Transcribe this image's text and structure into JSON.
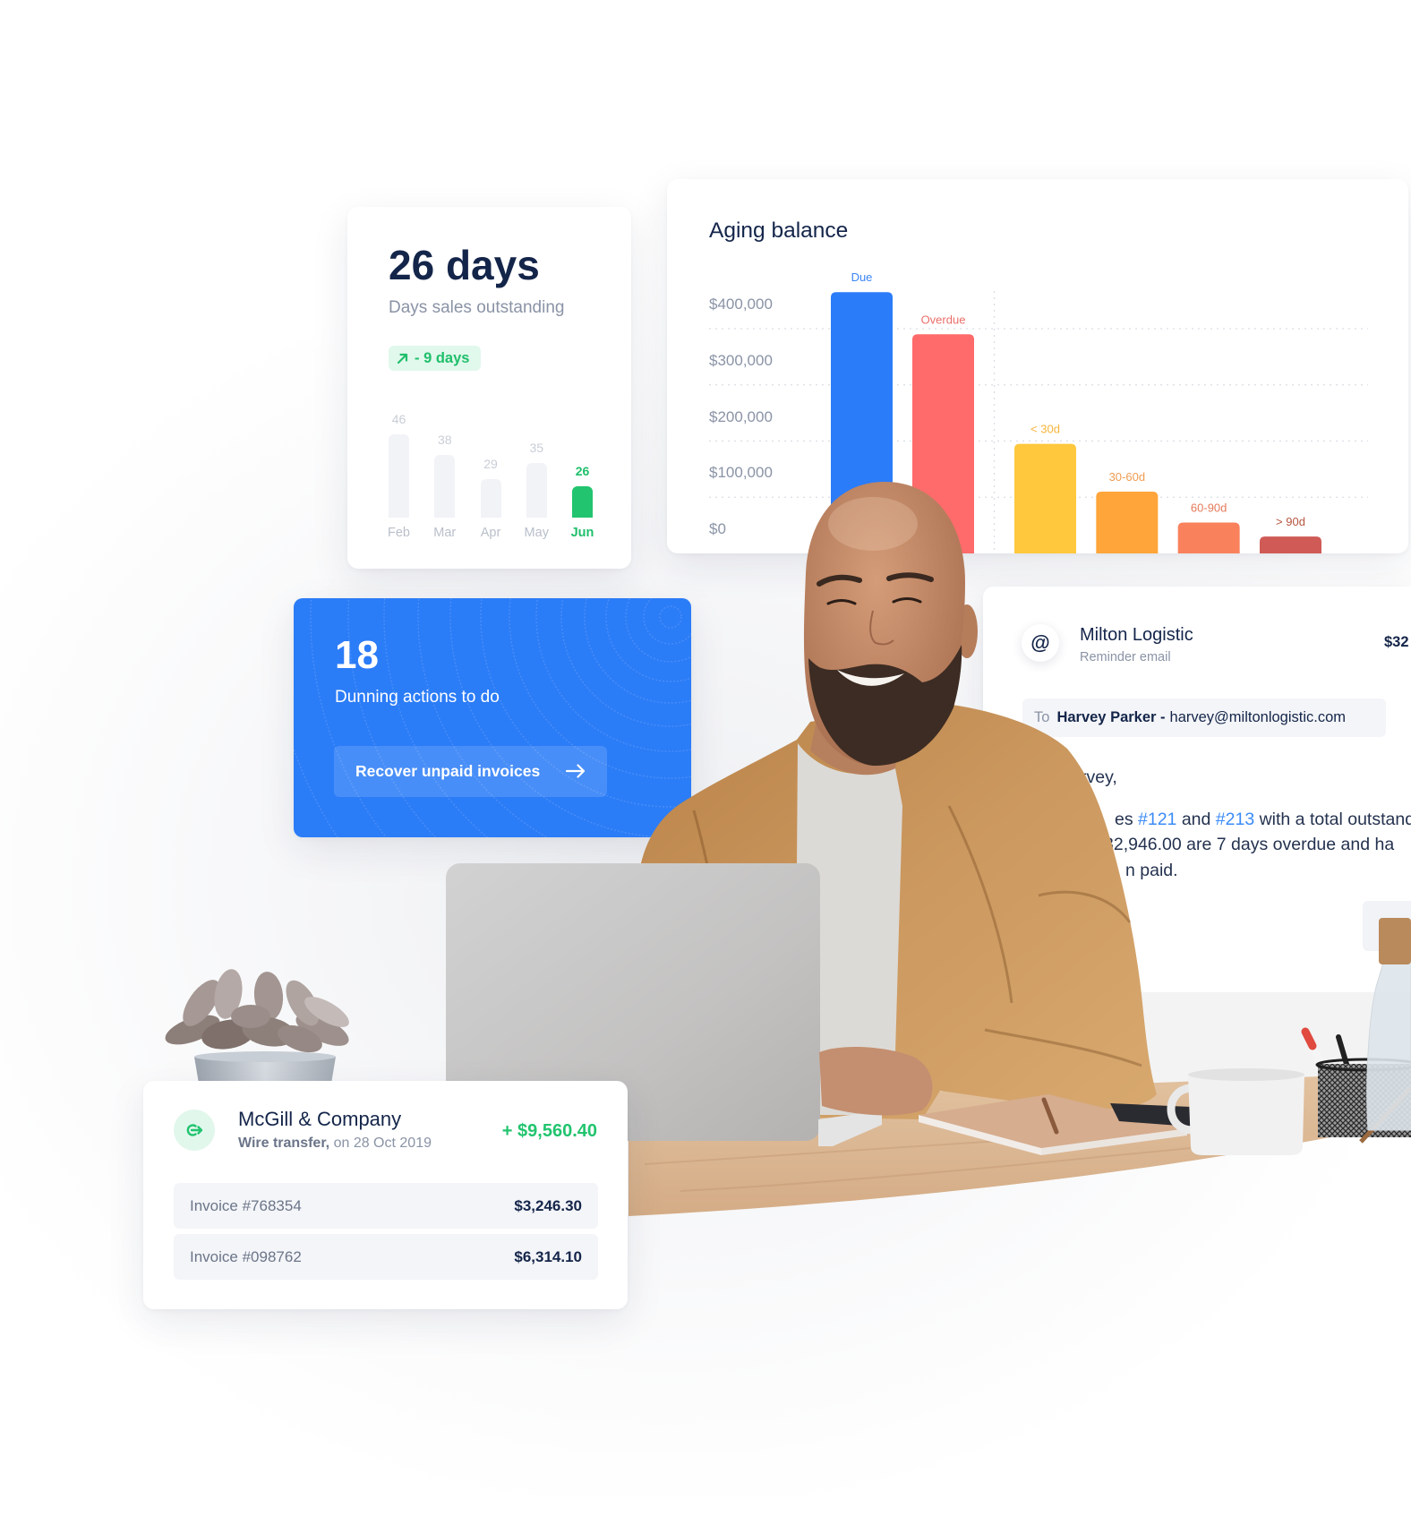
{
  "dso_card": {
    "value": "26 days",
    "label": "Days sales outstanding",
    "change": {
      "icon": "arrow-up-right-icon",
      "text": "- 9 days"
    }
  },
  "aging_card": {
    "title": "Aging balance"
  },
  "dunning_card": {
    "count": "18",
    "label": "Dunning actions to do",
    "button_label": "Recover unpaid invoices",
    "button_icon": "arrow-right-icon"
  },
  "email_card": {
    "icon": "at-sign-icon",
    "icon_glyph": "@",
    "company": "Milton Logistic",
    "type": "Reminder email",
    "amount_partial": "$32",
    "to_label": "To",
    "recipient_name": "Harvey Parker -",
    "recipient_email": "harvey@miltonlogistic.com",
    "body_lines": [
      [
        {
          "text": "rvey,"
        }
      ],
      [
        {
          "text": "es "
        },
        {
          "text": "#121",
          "link": true
        },
        {
          "text": " and "
        },
        {
          "text": "#213",
          "link": true
        },
        {
          "text": " with a total outstand"
        }
      ],
      [
        {
          "text": "32,946.00 are 7 days overdue and ha"
        }
      ],
      [
        {
          "text": "n paid."
        }
      ]
    ]
  },
  "payment_card": {
    "icon": "transfer-in-icon",
    "company": "McGill & Company",
    "method": "Wire transfer,",
    "date": " on 28 Oct 2019",
    "amount": "+ $9,560.40",
    "invoices": [
      {
        "label": "Invoice #768354",
        "amount": "$3,246.30"
      },
      {
        "label": "Invoice #098762",
        "amount": "$6,314.10"
      }
    ]
  },
  "colors": {
    "navy_text": "#14254a",
    "muted_text": "#8a93a6",
    "positive_green": "#22c46f",
    "primary_blue": "#2b7cf7",
    "link_blue": "#3b8bf6"
  },
  "chart_data": [
    {
      "id": "aging-balance",
      "type": "bar",
      "title": "Aging balance",
      "categories": [
        "Due",
        "Overdue",
        "< 30d",
        "30-60d",
        "60-90d",
        "> 90d"
      ],
      "groups": [
        "total",
        "total",
        "aging",
        "aging",
        "aging",
        "aging"
      ],
      "values": [
        465000,
        390000,
        195000,
        110000,
        55000,
        30000
      ],
      "colors": [
        "#2b7cf8",
        "#ff6b6b",
        "#ffc83d",
        "#ffa53a",
        "#f9825d",
        "#cf5a56"
      ],
      "label_colors": [
        "#3a86f5",
        "#ea6f6a",
        "#f7b53c",
        "#ef9c52",
        "#e57a5a",
        "#b65640"
      ],
      "yticks": [
        0,
        100000,
        200000,
        300000,
        400000
      ],
      "ytick_labels": [
        "$0",
        "$100,000",
        "$200,000",
        "$300,000",
        "$400,000"
      ],
      "ylim": [
        0,
        400000
      ],
      "xlabel": "",
      "ylabel": "",
      "grid": true,
      "legend": "none"
    },
    {
      "id": "dso-history",
      "type": "bar",
      "title": "Days sales outstanding",
      "categories": [
        "Feb",
        "Mar",
        "Apr",
        "May",
        "Jun"
      ],
      "values": [
        46,
        38,
        29,
        35,
        26
      ],
      "highlight": "Jun",
      "highlight_color": "#22c46f",
      "xlabel": "",
      "ylabel": "",
      "grid": false,
      "legend": "none"
    }
  ]
}
